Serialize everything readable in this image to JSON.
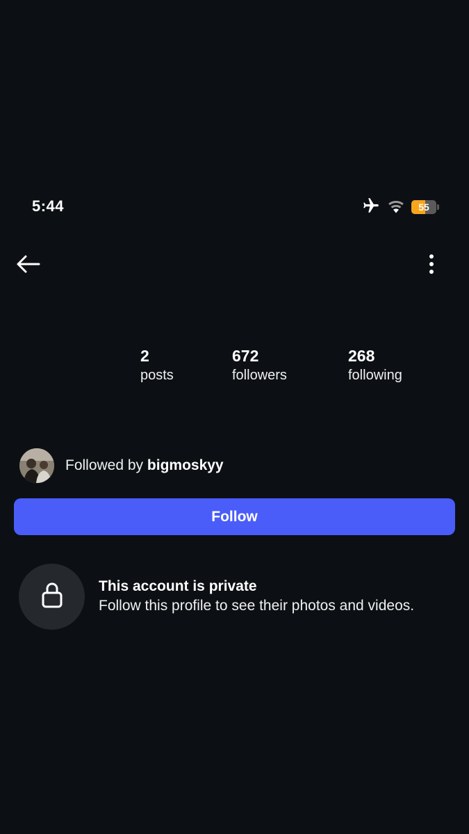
{
  "status_bar": {
    "time": "5:44",
    "battery_level": "55",
    "icons": [
      "airplane-mode-icon",
      "wifi-icon",
      "battery-icon"
    ],
    "battery_color": "#f7a51c"
  },
  "top_bar": {
    "icons": [
      "back-arrow-icon",
      "more-options-icon"
    ]
  },
  "stats": [
    {
      "count": "2",
      "label": "posts"
    },
    {
      "count": "672",
      "label": "followers"
    },
    {
      "count": "268",
      "label": "following"
    }
  ],
  "followed_by": {
    "prefix": "Followed by",
    "username": "bigmoskyy"
  },
  "follow_button": {
    "label": "Follow",
    "color": "#4a5df9"
  },
  "private_notice": {
    "icon": "lock-icon",
    "title": "This account is private",
    "subtitle": "Follow this profile to see their photos and videos."
  },
  "colors": {
    "background": "#0c1014",
    "text": "#ffffff",
    "lock_circle": "#25292e"
  }
}
